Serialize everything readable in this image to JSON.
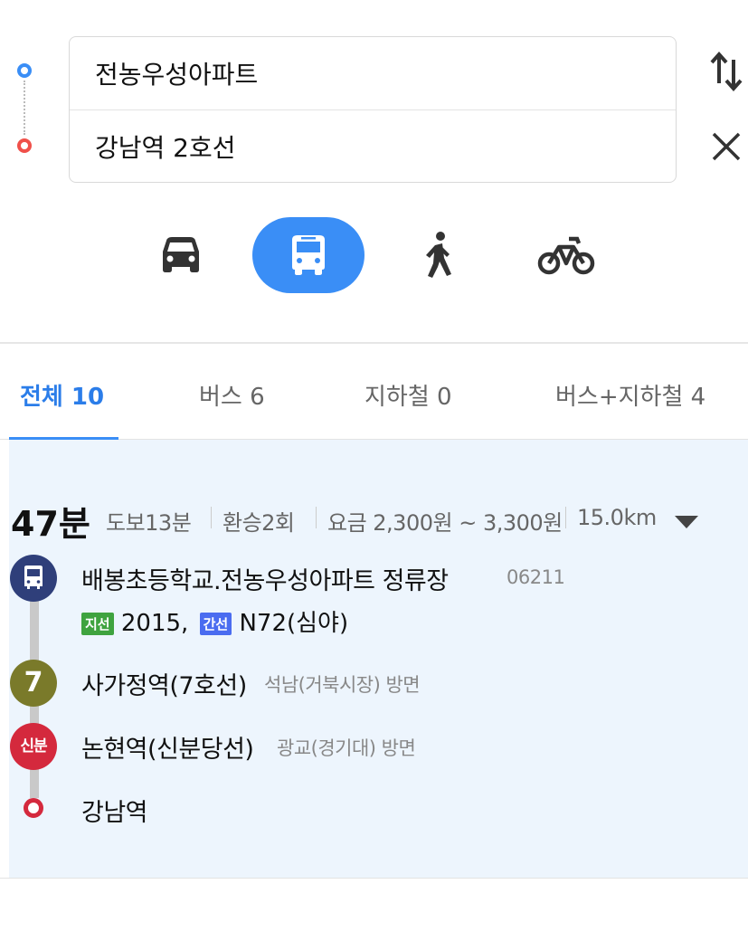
{
  "search": {
    "origin": "전농우성아파트",
    "destination": "강남역 2호선"
  },
  "modes": [
    {
      "name": "car",
      "icon": "car-icon",
      "active": false
    },
    {
      "name": "transit",
      "icon": "bus-icon",
      "active": true
    },
    {
      "name": "walk",
      "icon": "walk-icon",
      "active": false
    },
    {
      "name": "bike",
      "icon": "bicycle-icon",
      "active": false
    }
  ],
  "tabs": [
    {
      "label": "전체 10",
      "active": true
    },
    {
      "label": "버스 6",
      "active": false
    },
    {
      "label": "지하철 0",
      "active": false
    },
    {
      "label": "버스+지하철 4",
      "active": false
    }
  ],
  "route": {
    "duration": "47분",
    "walk": "도보13분",
    "transfers": "환승2회",
    "fare": "요금 2,300원 ~ 3,300원",
    "distance": "15.0km",
    "steps": [
      {
        "type": "bus",
        "stop": "배봉초등학교.전농우성아파트 정류장",
        "stop_id": "06211",
        "routes": [
          {
            "badge": "지선",
            "badge_color": "#3fa33f",
            "number": "2015,"
          },
          {
            "badge": "간선",
            "badge_color": "#4a6cf0",
            "number": "N72(심야)"
          }
        ]
      },
      {
        "type": "subway",
        "line_label": "7",
        "line_color": "#7a7a2a",
        "station": "사가정역(7호선)",
        "direction": "석남(거북시장) 방면"
      },
      {
        "type": "subway",
        "line_label": "신분",
        "line_color": "#d4293d",
        "station": "논현역(신분당선)",
        "direction": "광교(경기대) 방면"
      },
      {
        "type": "end",
        "station": "강남역"
      }
    ]
  },
  "colors": {
    "accent": "#3a8ef6",
    "panel_bg": "#edf5fd",
    "bus_circle": "#2f3f7a"
  }
}
